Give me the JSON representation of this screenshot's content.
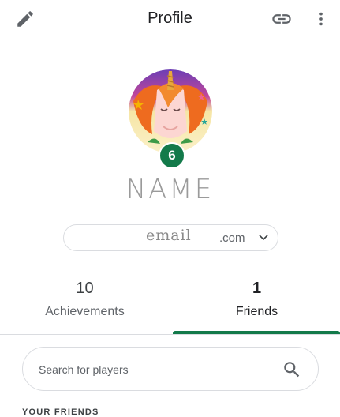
{
  "header": {
    "title": "Profile",
    "icons": {
      "edit": "pencil-icon",
      "link": "link-icon",
      "more": "more-vert-icon"
    }
  },
  "profile": {
    "name": "NAME",
    "level": "6",
    "avatar": "unicorn-avatar",
    "account_prefix": "email",
    "account_suffix": ".com"
  },
  "tabs": [
    {
      "count": "10",
      "label": "Achievements",
      "selected": false
    },
    {
      "count": "1",
      "label": "Friends",
      "selected": true
    }
  ],
  "search": {
    "placeholder": "Search for players",
    "value": ""
  },
  "section": {
    "heading": "YOUR FRIENDS"
  },
  "colors": {
    "accent": "#137a4a",
    "text": "#202124",
    "secondary": "#5f6368",
    "divider": "#dadce0"
  }
}
